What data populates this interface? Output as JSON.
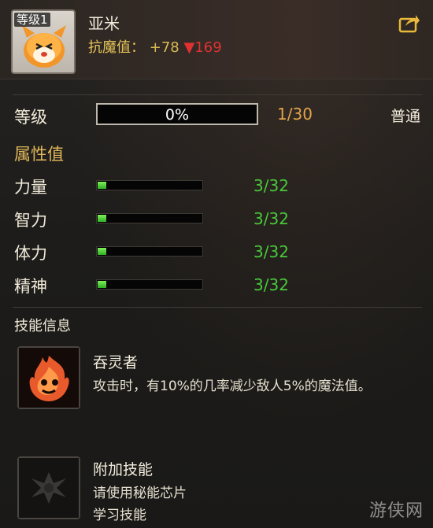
{
  "header": {
    "level_badge": "等级1",
    "pet_name": "亚米",
    "resist_label": "抗魔值：",
    "resist_plus": "+78",
    "resist_down_arrow": "▼",
    "resist_down_value": "169",
    "share_icon": "share-icon"
  },
  "level": {
    "label": "等级",
    "progress_text": "0%",
    "progress_fraction": 0.0,
    "count": "1/30",
    "quality": "普通"
  },
  "attributes": {
    "title": "属性值",
    "items": [
      {
        "label": "力量",
        "value": "3/32",
        "fill_fraction": 0.094
      },
      {
        "label": "智力",
        "value": "3/32",
        "fill_fraction": 0.094
      },
      {
        "label": "体力",
        "value": "3/32",
        "fill_fraction": 0.094
      },
      {
        "label": "精神",
        "value": "3/32",
        "fill_fraction": 0.094
      }
    ]
  },
  "skills": {
    "title": "技能信息",
    "main": {
      "name": "吞灵者",
      "description": "攻击时，有10%的几率减少敌人5%的魔法值。",
      "icon": "flame-spirit-icon"
    },
    "extra": {
      "name": "附加技能",
      "line1": "请使用秘能芯片",
      "line2": "学习技能",
      "icon": "locked-skill-emblem-icon"
    }
  },
  "colors": {
    "gold": "#e2b95a",
    "green": "#48c93a",
    "red": "#e03232",
    "orange": "#e3a44a"
  },
  "watermark": "游侠网"
}
